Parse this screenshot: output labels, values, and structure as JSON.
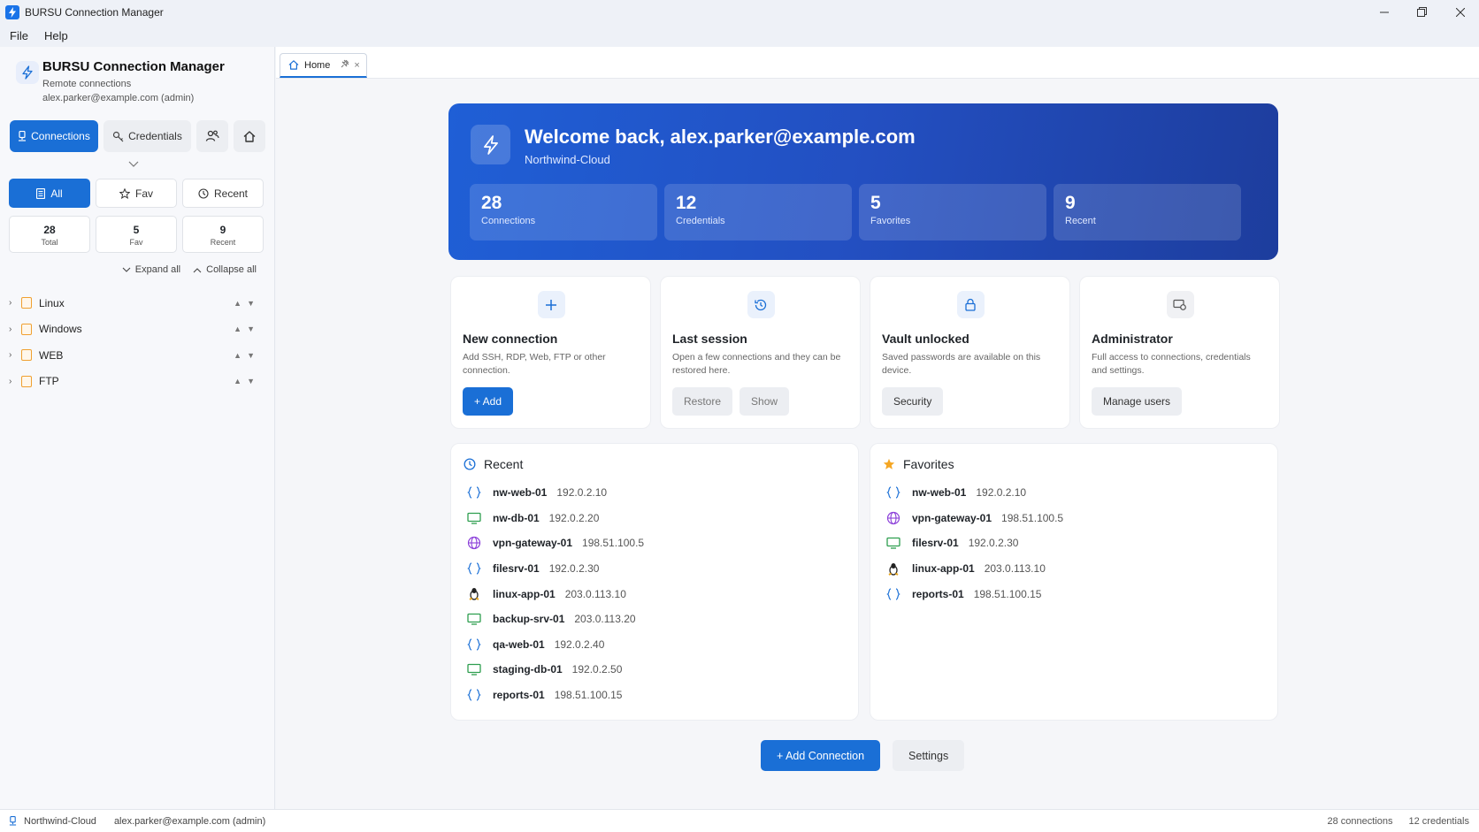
{
  "window": {
    "title": "BURSU Connection Manager"
  },
  "menu": [
    "File",
    "Help"
  ],
  "sidebar": {
    "brand_name": "BURSU Connection Manager",
    "brand_sub": "Remote connections",
    "user": "alex.parker@example.com (admin)",
    "modes": {
      "connections": "Connections",
      "credentials": "Credentials"
    },
    "filters": {
      "all": "All",
      "fav": "Fav",
      "recent": "Recent"
    },
    "counts": [
      {
        "num": "28",
        "label": "Total"
      },
      {
        "num": "5",
        "label": "Fav"
      },
      {
        "num": "9",
        "label": "Recent"
      }
    ],
    "expand_all": "Expand all",
    "collapse_all": "Collapse all",
    "folders": [
      "Linux",
      "Windows",
      "WEB",
      "FTP"
    ]
  },
  "tab": {
    "label": "Home"
  },
  "hero": {
    "title": "Welcome back, alex.parker@example.com",
    "subtitle": "Northwind-Cloud",
    "stats": [
      {
        "num": "28",
        "label": "Connections"
      },
      {
        "num": "12",
        "label": "Credentials"
      },
      {
        "num": "5",
        "label": "Favorites"
      },
      {
        "num": "9",
        "label": "Recent"
      }
    ]
  },
  "cards": {
    "new_connection": {
      "title": "New connection",
      "desc": "Add SSH, RDP, Web, FTP or other connection.",
      "button": "+ Add"
    },
    "last_session": {
      "title": "Last session",
      "desc": "Open a few connections and they can be restored here.",
      "restore": "Restore",
      "show": "Show"
    },
    "vault": {
      "title": "Vault unlocked",
      "desc": "Saved passwords are available on this device.",
      "button": "Security"
    },
    "admin": {
      "title": "Administrator",
      "desc": "Full access to connections, credentials and settings.",
      "button": "Manage users"
    }
  },
  "recent": {
    "title": "Recent",
    "items": [
      {
        "name": "nw-web-01",
        "ip": "192.0.2.10",
        "icon": "web"
      },
      {
        "name": "nw-db-01",
        "ip": "192.0.2.20",
        "icon": "rdp"
      },
      {
        "name": "vpn-gateway-01",
        "ip": "198.51.100.5",
        "icon": "globe"
      },
      {
        "name": "filesrv-01",
        "ip": "192.0.2.30",
        "icon": "web"
      },
      {
        "name": "linux-app-01",
        "ip": "203.0.113.10",
        "icon": "linux"
      },
      {
        "name": "backup-srv-01",
        "ip": "203.0.113.20",
        "icon": "rdp"
      },
      {
        "name": "qa-web-01",
        "ip": "192.0.2.40",
        "icon": "web"
      },
      {
        "name": "staging-db-01",
        "ip": "192.0.2.50",
        "icon": "rdp"
      },
      {
        "name": "reports-01",
        "ip": "198.51.100.15",
        "icon": "web"
      }
    ]
  },
  "favorites": {
    "title": "Favorites",
    "items": [
      {
        "name": "nw-web-01",
        "ip": "192.0.2.10",
        "icon": "web"
      },
      {
        "name": "vpn-gateway-01",
        "ip": "198.51.100.5",
        "icon": "globe"
      },
      {
        "name": "filesrv-01",
        "ip": "192.0.2.30",
        "icon": "rdp"
      },
      {
        "name": "linux-app-01",
        "ip": "203.0.113.10",
        "icon": "linux"
      },
      {
        "name": "reports-01",
        "ip": "198.51.100.15",
        "icon": "web"
      }
    ]
  },
  "actions": {
    "add_connection": "+ Add Connection",
    "settings": "Settings"
  },
  "status": {
    "workspace": "Northwind-Cloud",
    "user": "alex.parker@example.com (admin)",
    "connections": "28 connections",
    "credentials": "12 credentials"
  },
  "colors": {
    "accent": "#1a6fd6",
    "hero_start": "#1f5fd6",
    "hero_end": "#1d3d9d",
    "folder": "#f0a030"
  }
}
